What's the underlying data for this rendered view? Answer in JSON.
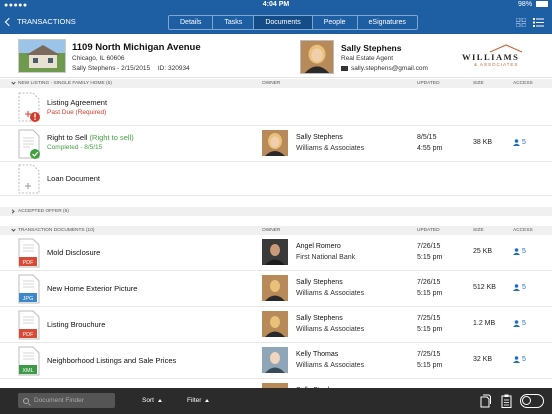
{
  "status": {
    "time": "4:04 PM",
    "battery": "98%",
    "battery_fill": 0.98
  },
  "nav": {
    "back_label": "TRANSACTIONS",
    "tabs": [
      {
        "label": "Details",
        "active": false
      },
      {
        "label": "Tasks",
        "active": false
      },
      {
        "label": "Documents",
        "active": true
      },
      {
        "label": "People",
        "active": false
      },
      {
        "label": "eSignatures",
        "active": false
      }
    ],
    "icons": [
      "grid-view-icon",
      "list-view-icon"
    ]
  },
  "listing": {
    "address": "1109 North Michigan Avenue",
    "city": "Chicago, IL 60606",
    "client": "Sally Stephens - 2/15/2015",
    "id": "ID: 320934"
  },
  "agent": {
    "name": "Sally Stephens",
    "title": "Real Estate Agent",
    "email": "sally.stephens@gmail.com",
    "brand": "WILLIAMS",
    "brand_sub": "& ASSOCIATES"
  },
  "columns": {
    "owner": "OWNER",
    "updated": "UPDATED",
    "size": "SIZE",
    "access": "ACCESS"
  },
  "sections": [
    {
      "title": "NEW LISTING - SINGLE FAMILY HOME (5)",
      "expanded": true,
      "rows": [
        {
          "name": "Listing Agreement",
          "status": "Past Due (Required)",
          "status_color": "#d33b2a",
          "icon": "document-past-due-icon"
        },
        {
          "name": "Right to Sell",
          "name_note": "(Right to sell)",
          "status": "Completed - 8/5/15",
          "status_color": "#42a142",
          "icon": "document-completed-icon",
          "owner": "Sally Stephens",
          "owner_co": "Williams & Associates",
          "date": "8/5/15",
          "time": "4:55 pm",
          "size": "38 KB",
          "access": "5"
        },
        {
          "name": "Loan Document",
          "icon": "document-add-icon"
        }
      ]
    },
    {
      "title": "ACCEPTED OFFER (6)",
      "expanded": false
    },
    {
      "title": "TRANSACTION DOCUMENTS (10)",
      "expanded": true,
      "rows": [
        {
          "name": "Mold Disclosure",
          "type": "PDF",
          "type_color": "#d64a36",
          "owner": "Angel Romero",
          "owner_co": "First National Bank",
          "date": "7/26/15",
          "time": "5:15 pm",
          "size": "25 KB",
          "access": "5"
        },
        {
          "name": "New Home Exterior Picture",
          "type": "JPG",
          "type_color": "#3d88c9",
          "owner": "Sally Stephens",
          "owner_co": "Williams & Associates",
          "date": "7/26/15",
          "time": "5:15 pm",
          "size": "512 KB",
          "access": "5"
        },
        {
          "name": "Listing Brouchure",
          "type": "PDF",
          "type_color": "#d64a36",
          "owner": "Sally Stephens",
          "owner_co": "Williams & Associates",
          "date": "7/25/15",
          "time": "5:15 pm",
          "size": "1.2 MB",
          "access": "5"
        },
        {
          "name": "Neighborhood Listings and Sale Prices",
          "type": "XML",
          "type_color": "#3d9a47",
          "owner": "Kelly Thomas",
          "owner_co": "Williams & Associates",
          "date": "7/25/15",
          "time": "5:15 pm",
          "size": "32 KB",
          "access": "5"
        },
        {
          "name": "",
          "owner": "Sally Stephens",
          "owner_co": "Williams & Associates"
        }
      ]
    }
  ],
  "toolbar": {
    "search_placeholder": "Document Finder",
    "sort": "Sort",
    "filter": "Filter"
  }
}
